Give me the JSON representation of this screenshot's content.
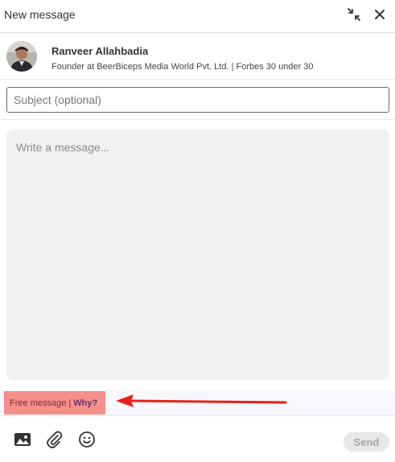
{
  "header": {
    "title": "New message",
    "minimize_icon": "collapse-arrows-icon",
    "close_icon": "close-icon"
  },
  "recipient": {
    "name": "Ranveer Allahbadia",
    "headline": "Founder at BeerBiceps Media World Pvt. Ltd. | Forbes 30 under 30"
  },
  "compose": {
    "subject_placeholder": "Subject (optional)",
    "subject_value": "",
    "message_placeholder": "Write a message...",
    "message_value": ""
  },
  "free_message": {
    "text": "Free message |",
    "why_label": "Why?",
    "highlight_color": "#f48f8a",
    "annotation_arrow_color": "#e8201a"
  },
  "footer": {
    "tools": [
      {
        "icon": "image-icon"
      },
      {
        "icon": "paperclip-icon"
      },
      {
        "icon": "emoji-icon"
      }
    ],
    "send_label": "Send"
  }
}
